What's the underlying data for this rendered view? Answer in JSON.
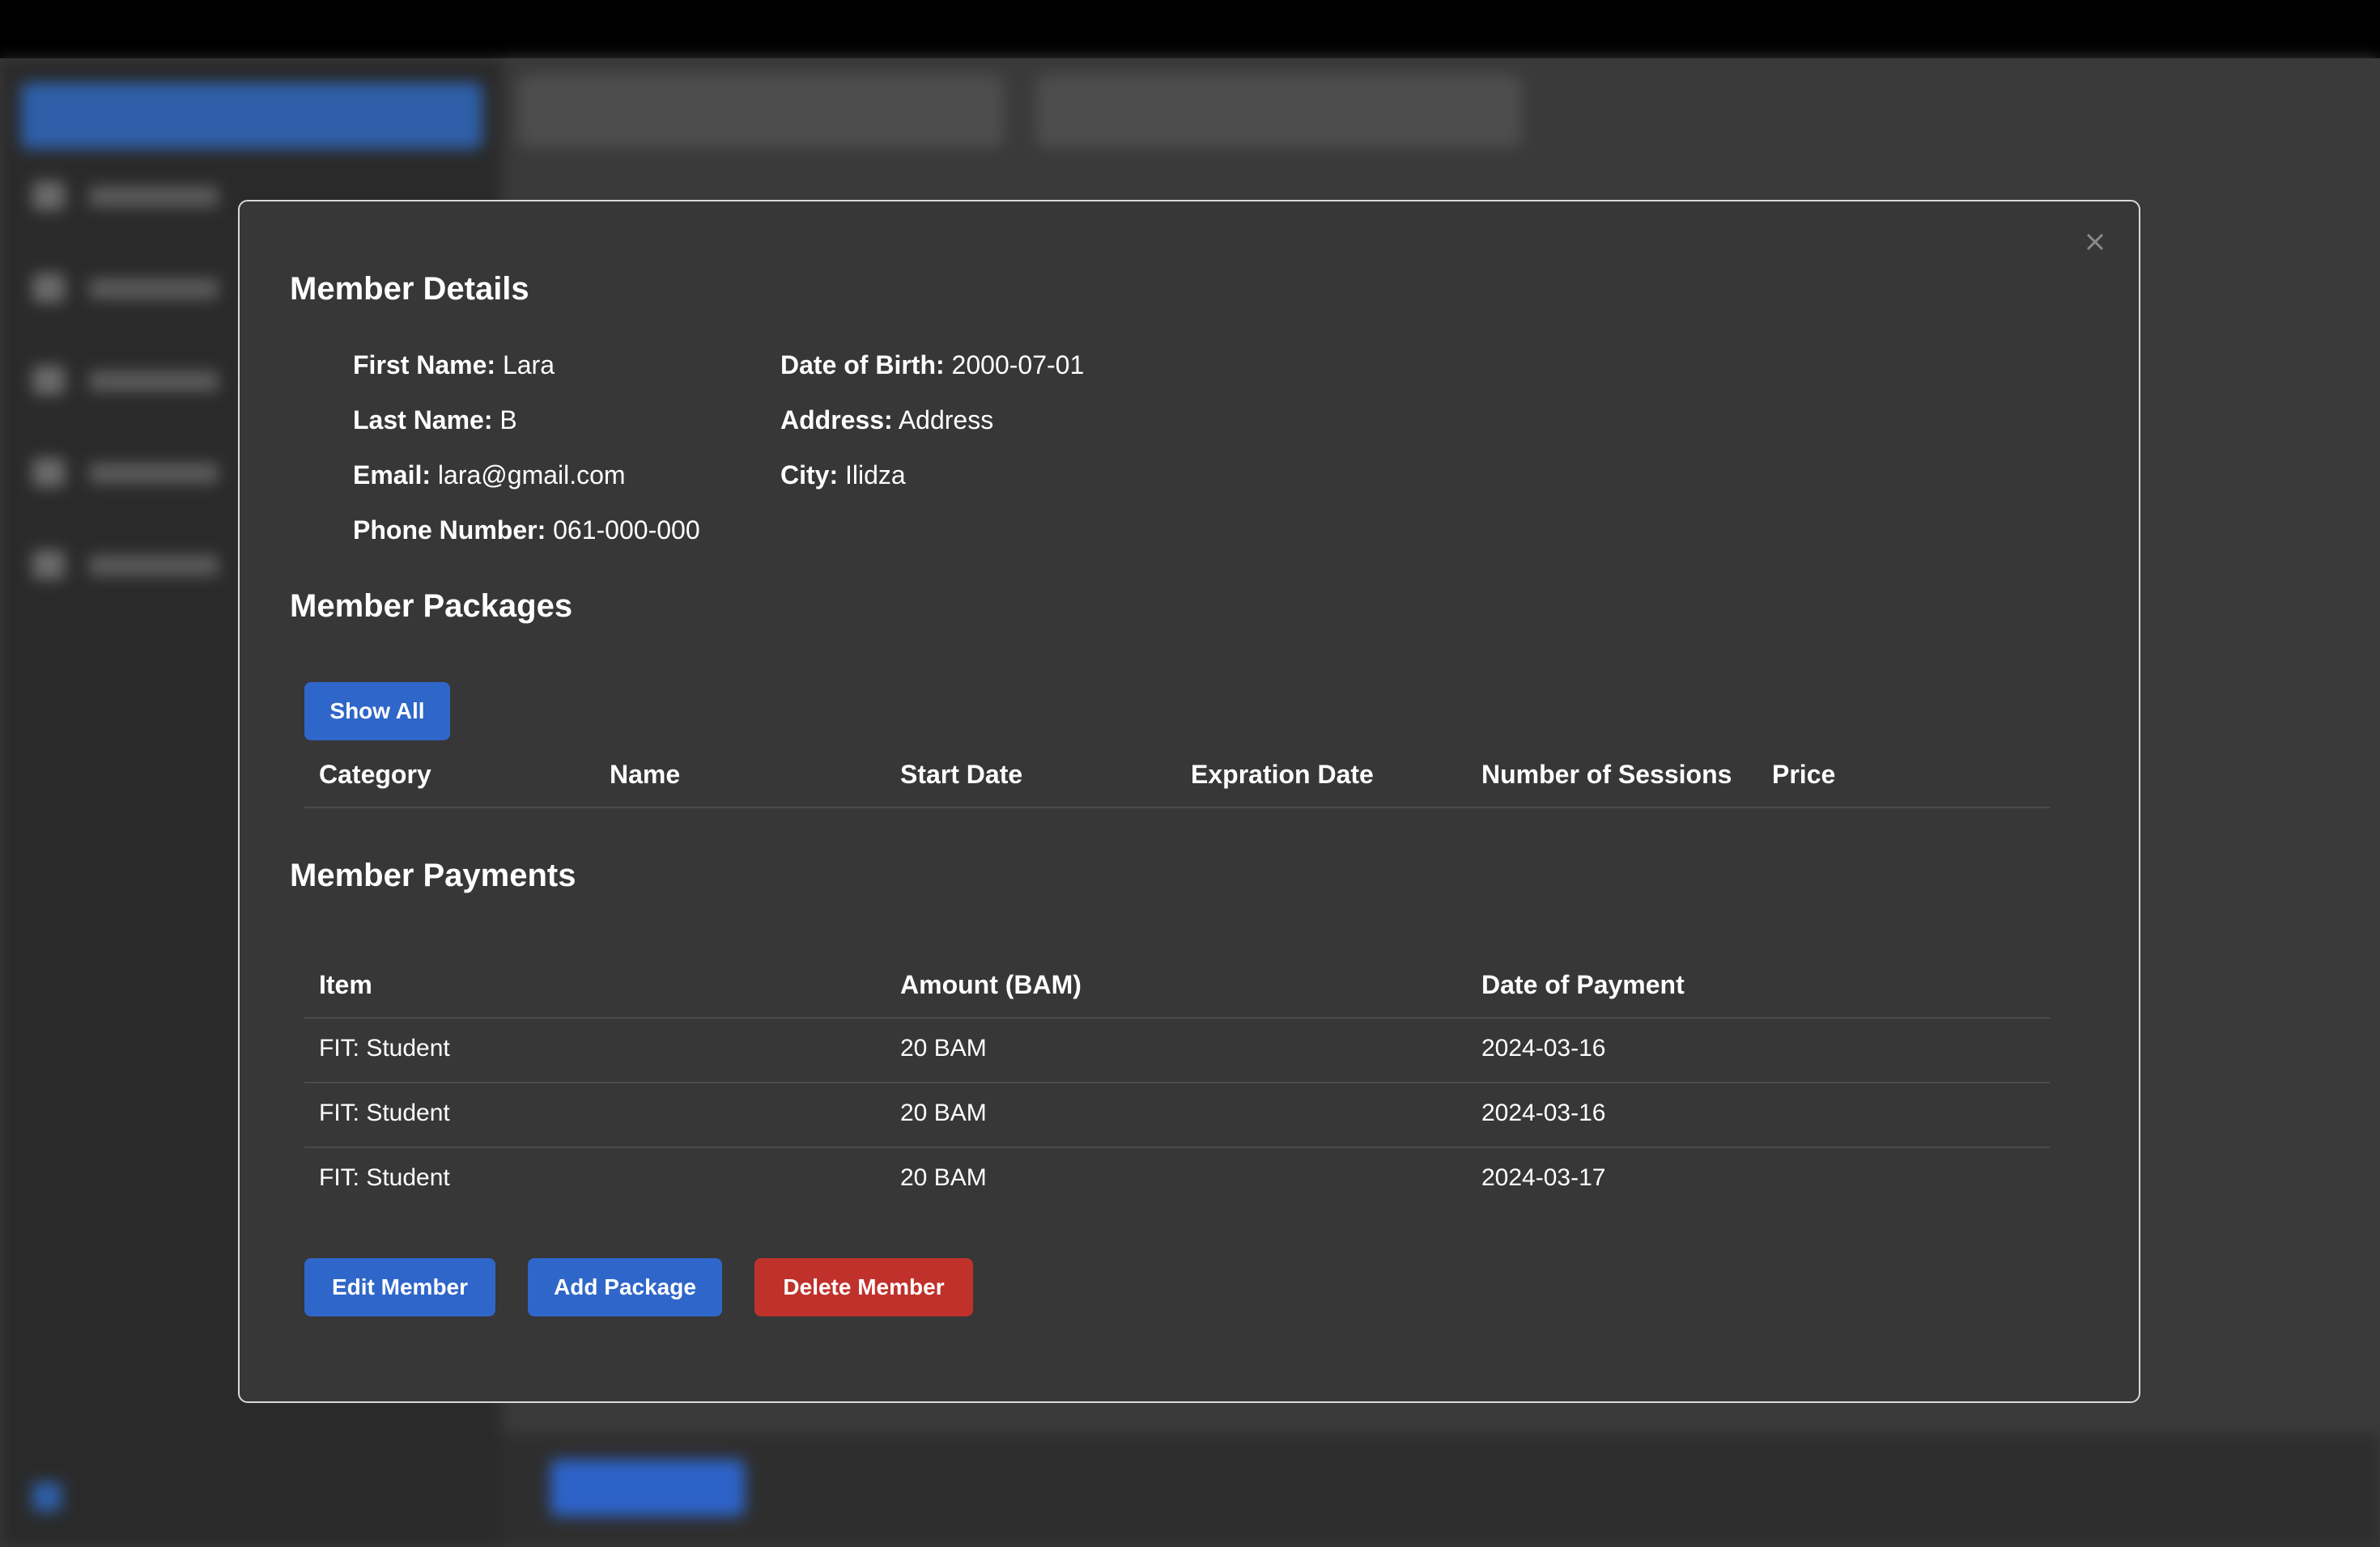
{
  "modal": {
    "member_details_title": "Member Details",
    "details": {
      "first_name_label": "First Name:",
      "first_name": "Lara",
      "last_name_label": "Last Name:",
      "last_name": "B",
      "email_label": "Email:",
      "email": "lara@gmail.com",
      "phone_label": "Phone Number:",
      "phone": "061-000-000",
      "dob_label": "Date of Birth:",
      "dob": "2000-07-01",
      "address_label": "Address:",
      "address": "Address",
      "city_label": "City:",
      "city": "Ilidza"
    },
    "packages": {
      "title": "Member Packages",
      "show_all_label": "Show All",
      "columns": [
        "Category",
        "Name",
        "Start Date",
        "Expration Date",
        "Number of Sessions",
        "Price"
      ],
      "rows": []
    },
    "payments": {
      "title": "Member Payments",
      "columns": [
        "Item",
        "Amount (BAM)",
        "Date of Payment"
      ],
      "rows": [
        {
          "item": "FIT: Student",
          "amount": "20 BAM",
          "date": "2024-03-16"
        },
        {
          "item": "FIT: Student",
          "amount": "20 BAM",
          "date": "2024-03-16"
        },
        {
          "item": "FIT: Student",
          "amount": "20 BAM",
          "date": "2024-03-17"
        }
      ]
    },
    "actions": {
      "edit_label": "Edit Member",
      "add_package_label": "Add Package",
      "delete_label": "Delete Member"
    }
  },
  "icons": {
    "close": "close-icon"
  },
  "colors": {
    "primary": "#2f66c9",
    "danger": "#c0312b",
    "modal_bg": "#373737",
    "backdrop": "#3a3a3a"
  }
}
